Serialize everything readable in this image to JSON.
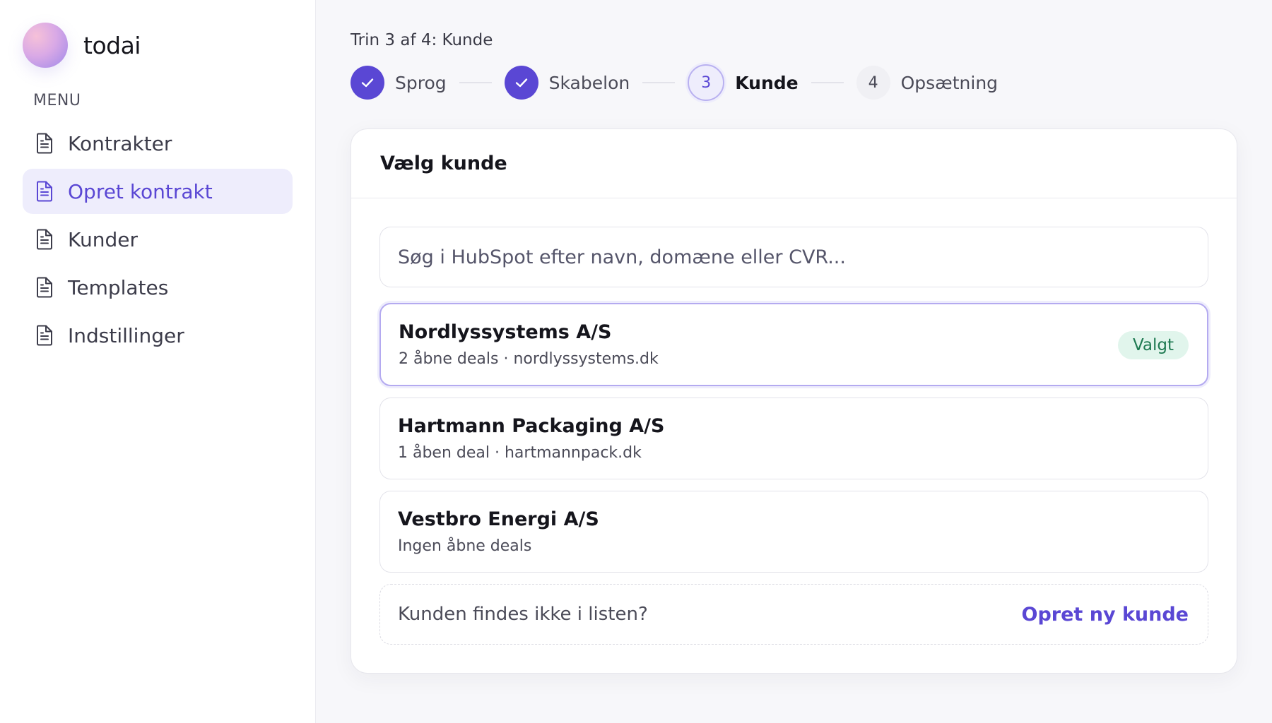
{
  "brand": {
    "name": "todai"
  },
  "sidebar": {
    "menu_label": "MENU",
    "items": [
      {
        "label": "Kontrakter",
        "icon": "document-icon",
        "active": false
      },
      {
        "label": "Opret kontrakt",
        "icon": "document-icon",
        "active": true
      },
      {
        "label": "Kunder",
        "icon": "document-icon",
        "active": false
      },
      {
        "label": "Templates",
        "icon": "document-icon",
        "active": false
      },
      {
        "label": "Indstillinger",
        "icon": "document-icon",
        "active": false
      }
    ]
  },
  "wizard": {
    "caption": "Trin 3 af 4: Kunde",
    "steps": [
      {
        "number": "1",
        "label": "Sprog",
        "state": "done"
      },
      {
        "number": "2",
        "label": "Skabelon",
        "state": "done"
      },
      {
        "number": "3",
        "label": "Kunde",
        "state": "current"
      },
      {
        "number": "4",
        "label": "Opsætning",
        "state": "todo"
      }
    ]
  },
  "card": {
    "title": "Vælg kunde",
    "search": {
      "placeholder": "Søg i HubSpot efter navn, domæne eller CVR...",
      "value": ""
    },
    "customers": [
      {
        "name": "Nordlyssystems A/S",
        "meta": "2 åbne deals · nordlyssystems.dk",
        "selected": true,
        "badge": "Valgt"
      },
      {
        "name": "Hartmann Packaging A/S",
        "meta": "1 åben deal · hartmannpack.dk",
        "selected": false
      },
      {
        "name": "Vestbro Energi A/S",
        "meta": "Ingen åbne deals",
        "selected": false
      }
    ],
    "not_found": {
      "text": "Kunden findes ikke i listen?",
      "link": "Opret ny kunde"
    }
  },
  "colors": {
    "accent": "#5a47d4",
    "accent_soft": "#eeedfc",
    "badge_bg": "#e1f5ec",
    "badge_text": "#1f7a52"
  }
}
